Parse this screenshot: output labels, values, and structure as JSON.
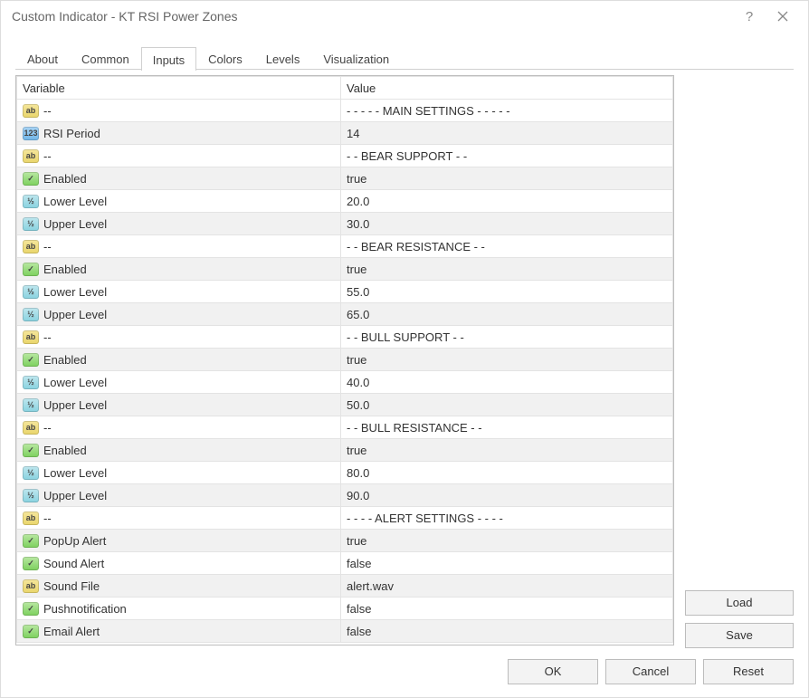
{
  "titlebar": {
    "title": "Custom Indicator - KT RSI Power Zones"
  },
  "tabs": [
    {
      "label": "About",
      "active": false
    },
    {
      "label": "Common",
      "active": false
    },
    {
      "label": "Inputs",
      "active": true
    },
    {
      "label": "Colors",
      "active": false
    },
    {
      "label": "Levels",
      "active": false
    },
    {
      "label": "Visualization",
      "active": false
    }
  ],
  "columns": {
    "variable": "Variable",
    "value": "Value"
  },
  "rows": [
    {
      "icon": "string",
      "var": "--",
      "val": "- - - - - MAIN SETTINGS - - - - -"
    },
    {
      "icon": "int",
      "var": "RSI Period",
      "val": "14"
    },
    {
      "icon": "string",
      "var": "--",
      "val": "- - BEAR SUPPORT - -"
    },
    {
      "icon": "bool",
      "var": "Enabled",
      "val": "true"
    },
    {
      "icon": "double",
      "var": "Lower Level",
      "val": "20.0"
    },
    {
      "icon": "double",
      "var": "Upper Level",
      "val": "30.0"
    },
    {
      "icon": "string",
      "var": "--",
      "val": "- - BEAR RESISTANCE - -"
    },
    {
      "icon": "bool",
      "var": "Enabled",
      "val": "true"
    },
    {
      "icon": "double",
      "var": "Lower Level",
      "val": "55.0"
    },
    {
      "icon": "double",
      "var": "Upper Level",
      "val": "65.0"
    },
    {
      "icon": "string",
      "var": "--",
      "val": "- - BULL SUPPORT - -"
    },
    {
      "icon": "bool",
      "var": "Enabled",
      "val": "true"
    },
    {
      "icon": "double",
      "var": "Lower Level",
      "val": "40.0"
    },
    {
      "icon": "double",
      "var": "Upper Level",
      "val": "50.0"
    },
    {
      "icon": "string",
      "var": "--",
      "val": "- - BULL RESISTANCE - -"
    },
    {
      "icon": "bool",
      "var": "Enabled",
      "val": "true"
    },
    {
      "icon": "double",
      "var": "Lower Level",
      "val": "80.0"
    },
    {
      "icon": "double",
      "var": "Upper Level",
      "val": "90.0"
    },
    {
      "icon": "string",
      "var": "--",
      "val": "- - - - ALERT SETTINGS - - - -"
    },
    {
      "icon": "bool",
      "var": "PopUp Alert",
      "val": "true"
    },
    {
      "icon": "bool",
      "var": "Sound Alert",
      "val": "false"
    },
    {
      "icon": "string",
      "var": "Sound File",
      "val": "alert.wav"
    },
    {
      "icon": "bool",
      "var": "Pushnotification",
      "val": "false"
    },
    {
      "icon": "bool",
      "var": "Email Alert",
      "val": "false"
    }
  ],
  "side": {
    "load": "Load",
    "save": "Save"
  },
  "footer": {
    "ok": "OK",
    "cancel": "Cancel",
    "reset": "Reset"
  },
  "icon_glyph": {
    "string": "ab",
    "int": "123",
    "bool": "✓",
    "double": "½"
  }
}
